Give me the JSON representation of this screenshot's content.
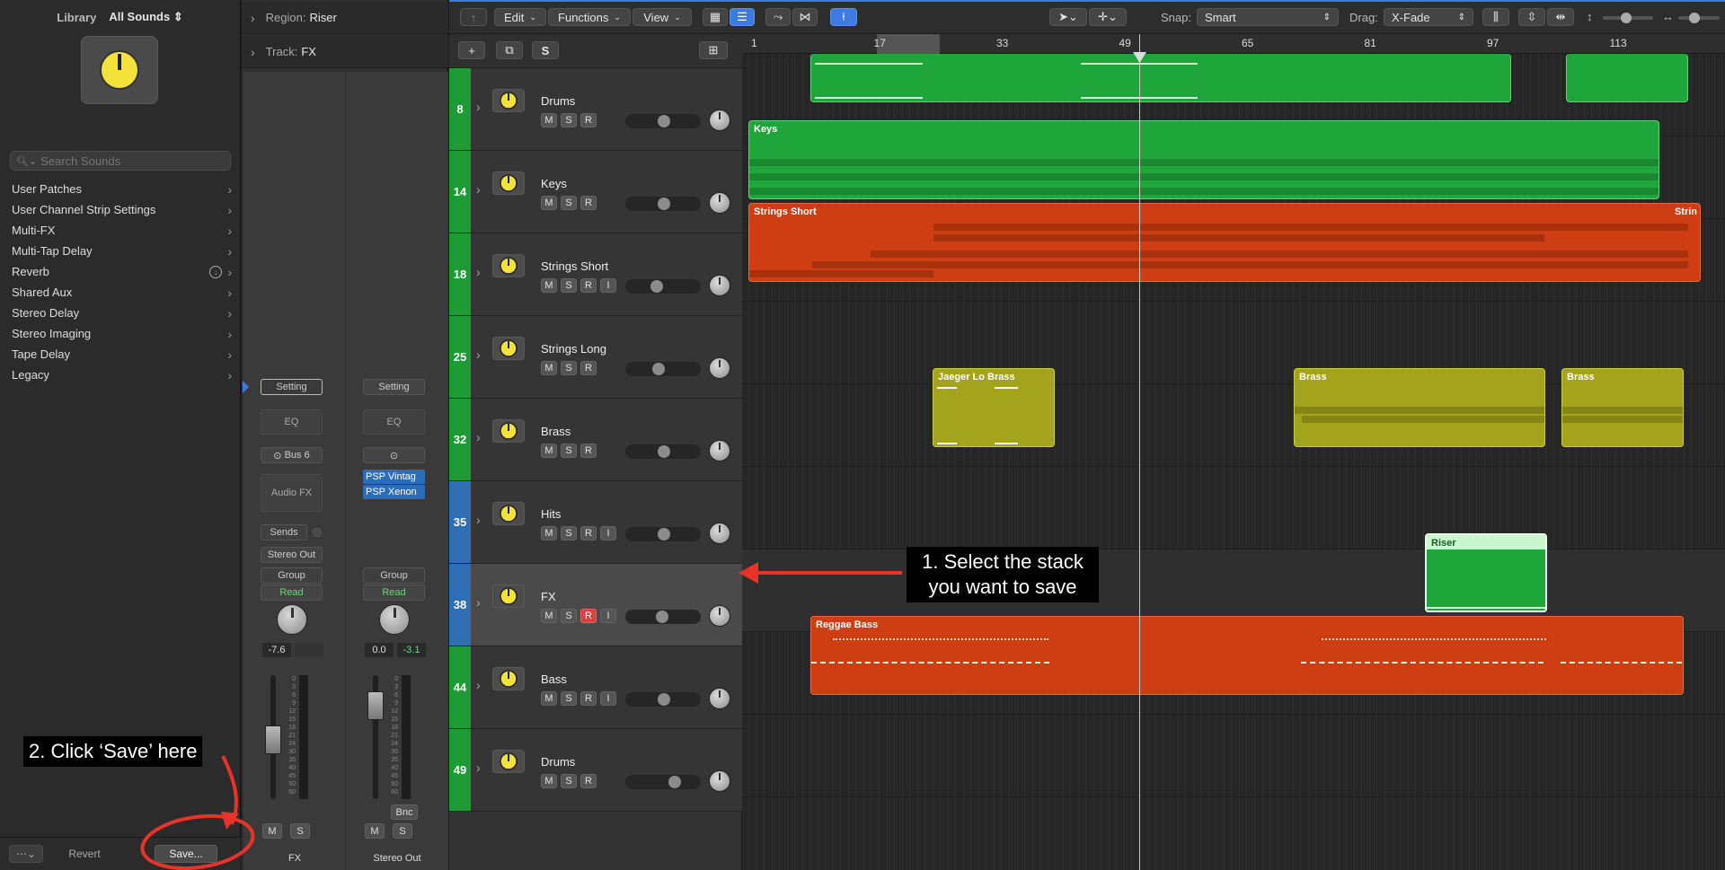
{
  "library": {
    "title": "Library",
    "selector": "All Sounds",
    "search_placeholder": "Search Sounds",
    "items": [
      {
        "label": "User Patches"
      },
      {
        "label": "User Channel Strip Settings"
      },
      {
        "label": "Multi-FX"
      },
      {
        "label": "Multi-Tap Delay"
      },
      {
        "label": "Reverb"
      },
      {
        "label": "Shared Aux"
      },
      {
        "label": "Stereo Delay"
      },
      {
        "label": "Stereo Imaging"
      },
      {
        "label": "Tape Delay"
      },
      {
        "label": "Legacy"
      }
    ],
    "revert_label": "Revert",
    "save_label": "Save..."
  },
  "inspector": {
    "region_key": "Region:",
    "region_value": "Riser",
    "track_key": "Track:",
    "track_value": "FX",
    "strip1": {
      "setting": "Setting",
      "eq": "EQ",
      "send_bus": "Bus 6",
      "audio_fx": "Audio FX",
      "sends": "Sends",
      "output": "Stereo Out",
      "group": "Group",
      "automation": "Read",
      "volume": "-7.6",
      "peak": "",
      "mute": "M",
      "solo": "S",
      "name": "FX"
    },
    "strip2": {
      "setting": "Setting",
      "eq": "EQ",
      "plugins": [
        "PSP Vintag",
        "PSP Xenon"
      ],
      "group": "Group",
      "automation": "Read",
      "volume": "0.0",
      "peak": "-3.1",
      "bnc": "Bnc",
      "mute": "M",
      "solo": "S",
      "name": "Stereo Out"
    },
    "scale": [
      "0",
      "3",
      "6",
      "9",
      "12",
      "15",
      "18",
      "21",
      "24",
      "30",
      "35",
      "40",
      "45",
      "50",
      "60"
    ]
  },
  "toolbar": {
    "edit": "Edit",
    "functions": "Functions",
    "view": "View",
    "snap_label": "Snap:",
    "snap_value": "Smart",
    "drag_label": "Drag:",
    "drag_value": "X-Fade"
  },
  "header_tools": {
    "s_label": "S"
  },
  "ruler": {
    "bars": [
      "1",
      "17",
      "33",
      "49",
      "65",
      "81",
      "97",
      "113"
    ]
  },
  "tracks": [
    {
      "num": "8",
      "name": "Drums",
      "color": "#1d9b34",
      "buttons": [
        "M",
        "S",
        "R"
      ]
    },
    {
      "num": "14",
      "name": "Keys",
      "color": "#1d9b34",
      "buttons": [
        "M",
        "S",
        "R"
      ]
    },
    {
      "num": "18",
      "name": "Strings Short",
      "color": "#1d9b34",
      "buttons": [
        "M",
        "S",
        "R",
        "I"
      ]
    },
    {
      "num": "25",
      "name": "Strings Long",
      "color": "#1d9b34",
      "buttons": [
        "M",
        "S",
        "R"
      ]
    },
    {
      "num": "32",
      "name": "Brass",
      "color": "#1d9b34",
      "buttons": [
        "M",
        "S",
        "R"
      ]
    },
    {
      "num": "35",
      "name": "Hits",
      "color": "#2f6db4",
      "buttons": [
        "M",
        "S",
        "R",
        "I"
      ]
    },
    {
      "num": "38",
      "name": "FX",
      "color": "#2f6db4",
      "buttons": [
        "M",
        "S",
        "R",
        "I"
      ],
      "selected": true
    },
    {
      "num": "44",
      "name": "Bass",
      "color": "#1d9b34",
      "buttons": [
        "M",
        "S",
        "R",
        "I"
      ]
    },
    {
      "num": "49",
      "name": "Drums",
      "color": "#1d9b34",
      "buttons": [
        "M",
        "S",
        "R"
      ]
    }
  ],
  "regions": {
    "keys": "Keys",
    "strings_short": "Strings Short",
    "strings_short_tail": "Strin",
    "brass1": "Jaeger Lo Brass",
    "brass2": "Brass",
    "brass3": "Brass",
    "riser": "Riser",
    "bass": "Reggae Bass"
  },
  "annotations": {
    "step1_line1": "1. Select the stack",
    "step1_line2": "you want to save",
    "step2": "2. Click ‘Save’ here"
  },
  "colors": {
    "accent": "#3d7be0",
    "annotation": "#e8332a",
    "knob": "#f2e23a"
  }
}
